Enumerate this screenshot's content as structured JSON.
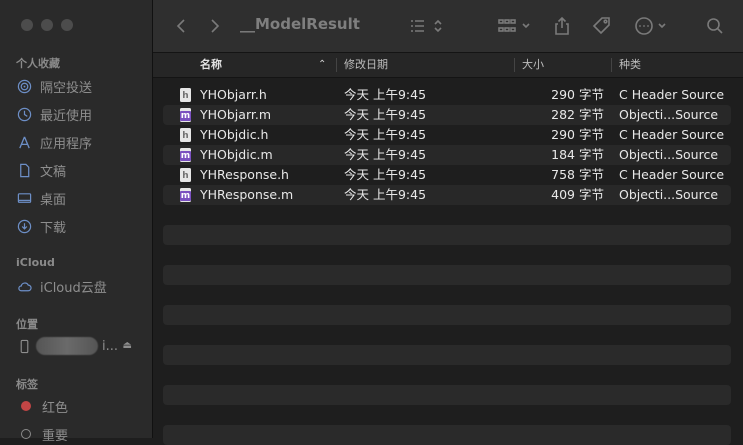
{
  "window": {
    "title": "__ModelResult"
  },
  "sidebar": {
    "favorites_title": "个人收藏",
    "favorites": [
      {
        "label": "隔空投送",
        "icon": "airdrop-icon"
      },
      {
        "label": "最近使用",
        "icon": "clock-icon"
      },
      {
        "label": "应用程序",
        "icon": "apps-icon"
      },
      {
        "label": "文稿",
        "icon": "document-icon"
      },
      {
        "label": "桌面",
        "icon": "desktop-icon"
      },
      {
        "label": "下载",
        "icon": "download-icon"
      }
    ],
    "icloud_title": "iCloud",
    "icloud_items": [
      {
        "label": "iCloud云盘",
        "icon": "cloud-icon"
      }
    ],
    "locations_title": "位置",
    "locations": [
      {
        "label_suffix": "i...",
        "icon": "phone-icon"
      }
    ],
    "tags_title": "标签",
    "tags": [
      {
        "label": "红色",
        "color": "#c24545"
      },
      {
        "label": "重要",
        "color": "#8a8a8a"
      }
    ]
  },
  "columns": {
    "name": "名称",
    "date": "修改日期",
    "size": "大小",
    "kind": "种类"
  },
  "files": [
    {
      "name": "YHObjarr.h",
      "date": "今天 上午9:45",
      "size": "290 字节",
      "kind": "C Header Source",
      "type": "h"
    },
    {
      "name": "YHObjarr.m",
      "date": "今天 上午9:45",
      "size": "282 字节",
      "kind": "Objecti...Source",
      "type": "m"
    },
    {
      "name": "YHObjdic.h",
      "date": "今天 上午9:45",
      "size": "290 字节",
      "kind": "C Header Source",
      "type": "h"
    },
    {
      "name": "YHObjdic.m",
      "date": "今天 上午9:45",
      "size": "184 字节",
      "kind": "Objecti...Source",
      "type": "m"
    },
    {
      "name": "YHResponse.h",
      "date": "今天 上午9:45",
      "size": "758 字节",
      "kind": "C Header Source",
      "type": "h"
    },
    {
      "name": "YHResponse.m",
      "date": "今天 上午9:45",
      "size": "409 字节",
      "kind": "Objecti...Source",
      "type": "m"
    }
  ],
  "file_icon_letters": {
    "h": "h",
    "m": "m"
  },
  "colors": {
    "tag_red": "#c24545",
    "objc_purple": "#7a4fc0"
  }
}
